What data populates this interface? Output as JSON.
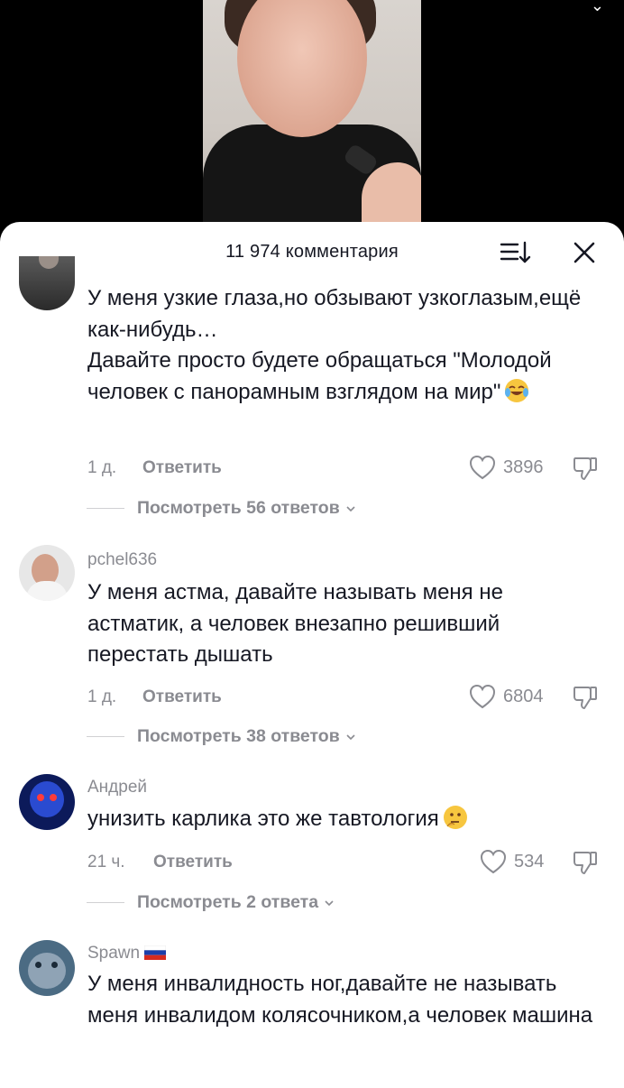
{
  "header": {
    "comment_count": "11 974 комментария"
  },
  "icons": {
    "sort": "sort-icon",
    "close": "close-icon",
    "heart": "heart-icon",
    "dislike": "thumbs-down-icon"
  },
  "comments": [
    {
      "username": "",
      "text": "У меня узкие глаза,но обзывают узкоглазым,ещё как-нибудь…\nДавайте просто будете обращаться \"Молодой человек с панорамным взглядом на мир\"",
      "emoji": "face-with-tears-of-joy",
      "time": "1 д.",
      "reply_label": "Ответить",
      "likes": "3896",
      "view_replies": "Посмотреть 56 ответов"
    },
    {
      "username": "pchel636",
      "text": "У меня астма, давайте называть меня не астматик, а человек внезапно решивший перестать дышать",
      "time": "1 д.",
      "reply_label": "Ответить",
      "likes": "6804",
      "view_replies": "Посмотреть 38 ответов"
    },
    {
      "username": "Андрей",
      "text": "унизить карлика это же тавтология",
      "emoji": "thinking-face",
      "time": "21 ч.",
      "reply_label": "Ответить",
      "likes": "534",
      "view_replies": "Посмотреть 2 ответа"
    },
    {
      "username": "Spawn",
      "username_flag": "russian-flag",
      "text": "У меня инвалидность ног,давайте не называть меня инвалидом колясочником,а человек машина"
    }
  ],
  "colors": {
    "text": "#161823",
    "muted": "#8a8b91",
    "sheet": "#ffffff",
    "background": "#000000"
  }
}
